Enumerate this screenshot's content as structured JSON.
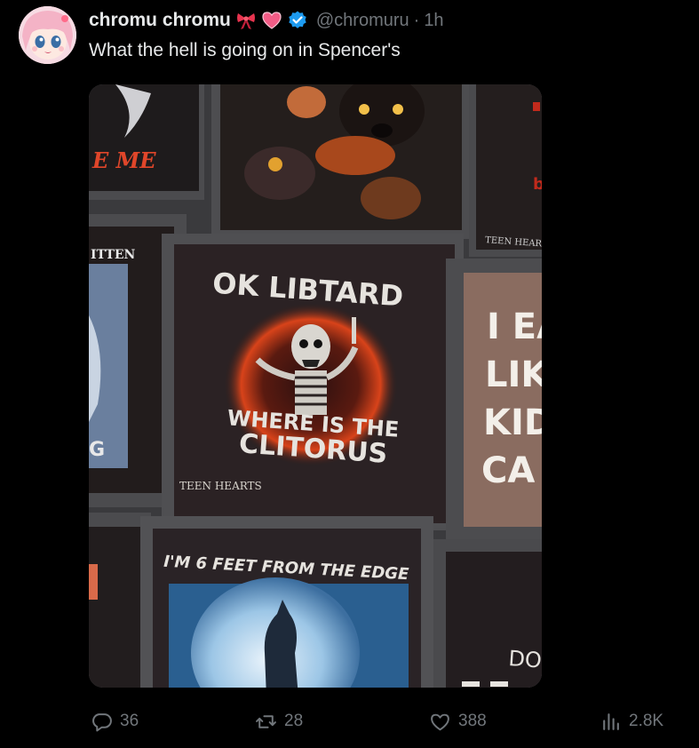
{
  "tweet": {
    "display_name": "chromu chromu",
    "handle": "@chromuru",
    "separator": "·",
    "time": "1h",
    "text": "What the hell is going on in Spencer's",
    "emoji": [
      "ribbon-icon",
      "heart-icon"
    ]
  },
  "media": {
    "signs": {
      "top_left": "E ME",
      "mid_left": "ITTEN",
      "center_top": "OK LIBTARD",
      "center_bottom_line1": "WHERE IS THE",
      "center_bottom_line2": "CLITORUS",
      "center_brand": "TEEN HEARTS",
      "top_right_brand": "TEEN HEART",
      "right_line1": "I EA",
      "right_line2": "LIK",
      "right_line3": "KID",
      "right_line4": "CA",
      "bottom_center": "I'M 6 FEET FROM THE EDGE",
      "bottom_right": "DON"
    }
  },
  "actions": {
    "replies": "36",
    "retweets": "28",
    "likes": "388",
    "views": "2.8K"
  },
  "colors": {
    "background": "#000000",
    "text_primary": "#e7e9ea",
    "text_secondary": "#71767b",
    "verified": "#1d9bf0"
  }
}
